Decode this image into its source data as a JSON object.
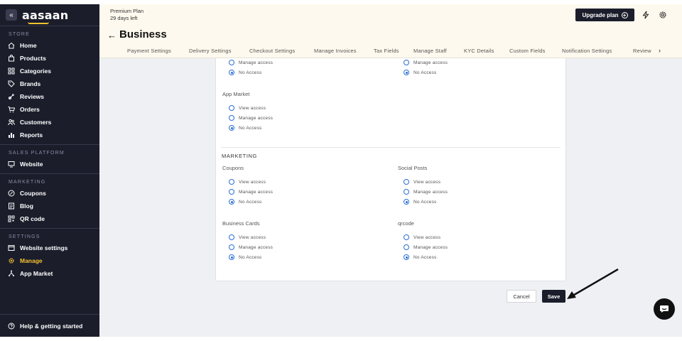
{
  "sidebar": {
    "logo": "aasaan",
    "collapse_icon": "«",
    "sections": {
      "store": "STORE",
      "sales_platform": "SALES PLATFORM",
      "marketing": "MARKETING",
      "settings": "SETTINGS"
    },
    "store_items": [
      "Home",
      "Products",
      "Categories",
      "Brands",
      "Reviews",
      "Orders",
      "Customers",
      "Reports"
    ],
    "sales_items": [
      "Website"
    ],
    "marketing_items": [
      "Coupons",
      "Blog",
      "QR code"
    ],
    "settings_items": [
      "Website settings",
      "Manage",
      "App Market"
    ],
    "active_item": "Manage",
    "help": "Help & getting started",
    "accent_color": "#f5c230"
  },
  "header": {
    "plan_name": "Premium Plan",
    "plan_days": "29 days left",
    "upgrade_label": "Upgrade plan",
    "page_title": "Business",
    "tabs": [
      "Payment Settings",
      "Delivery Settings",
      "Checkout Settings",
      "Manage Invoices",
      "Tax Fields",
      "Manage Staff",
      "KYC Details",
      "Custom Fields",
      "Notification Settings",
      "Review"
    ],
    "tab_more": "›"
  },
  "permissions": {
    "options": {
      "view": "View access",
      "manage": "Manage access",
      "none": "No Access"
    },
    "app_market_title": "App Market",
    "marketing_section": "MARKETING",
    "coupons_title": "Coupons",
    "social_posts_title": "Social Posts",
    "business_cards_title": "Business Cards",
    "qrcode_title": "qrcode",
    "selected": "No Access"
  },
  "actions": {
    "cancel": "Cancel",
    "save": "Save"
  },
  "colors": {
    "sidebar_bg": "#1b1d2b",
    "header_bg": "#fdf9ee",
    "radio": "#2a6fd3"
  }
}
